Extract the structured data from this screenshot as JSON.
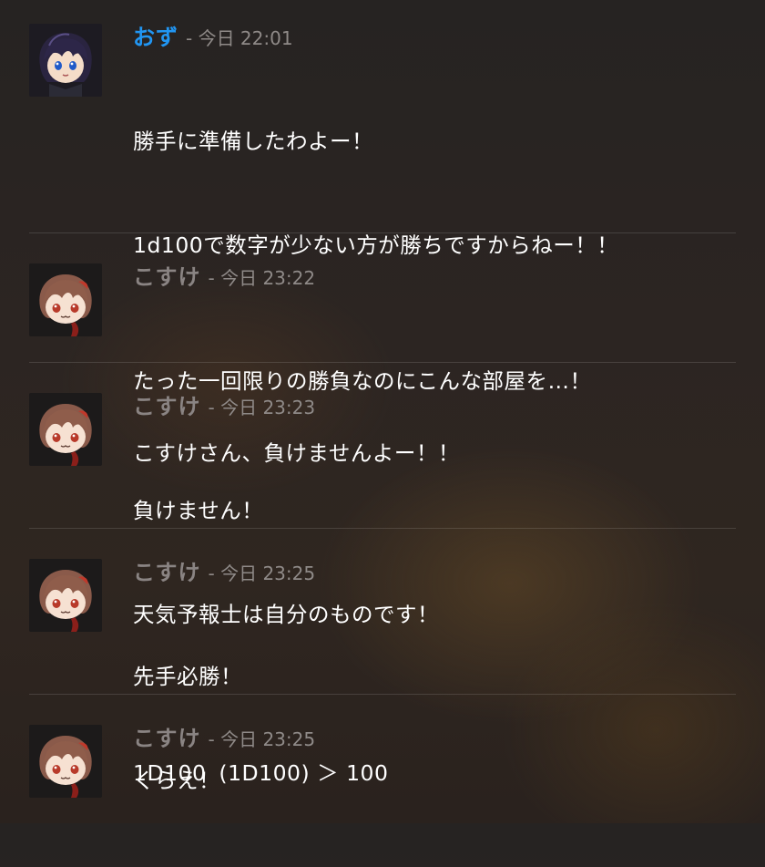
{
  "messages": [
    {
      "author": "おず",
      "author_color": "#2196f3",
      "timestamp": "- 今日 22:01",
      "avatar": "oz-avatar",
      "lines": [
        "勝手に準備したわよー！",
        "1d100で数字が少ない方が勝ちですからねー！！",
        "",
        "こすけさん、負けませんよー！！"
      ]
    },
    {
      "author": "こすけ",
      "author_color": "#8a8483",
      "timestamp": "- 今日 23:22",
      "avatar": "kosuke-avatar",
      "lines": [
        "たった一回限りの勝負なのにこんな部屋を…！"
      ]
    },
    {
      "author": "こすけ",
      "author_color": "#8a8483",
      "timestamp": "- 今日 23:23",
      "avatar": "kosuke-avatar",
      "lines": [
        "負けません！",
        "天気予報士は自分のものです！"
      ]
    },
    {
      "author": "こすけ",
      "author_color": "#8a8483",
      "timestamp": "- 今日 23:25",
      "avatar": "kosuke-avatar",
      "lines": [
        "先手必勝！",
        "くらえ！"
      ]
    },
    {
      "author": "こすけ",
      "author_color": "#8a8483",
      "timestamp": "- 今日 23:25",
      "avatar": "kosuke-avatar",
      "dice": {
        "command": "1D100",
        "result": "(1D100) ＞ 100"
      }
    }
  ]
}
